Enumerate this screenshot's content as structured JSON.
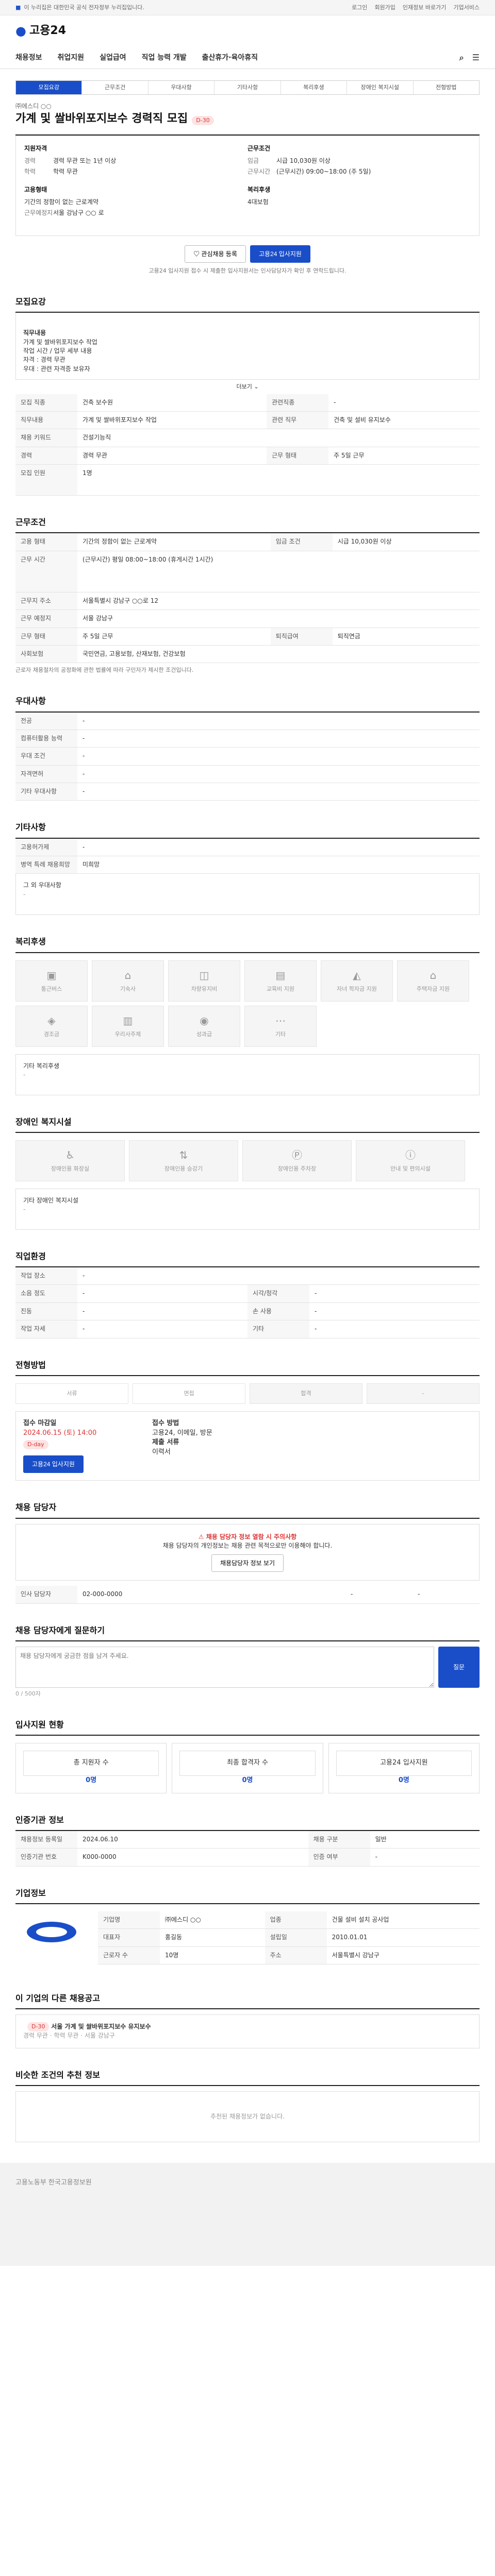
{
  "topbar": {
    "gov": "이 누리집은 대한민국 공식 전자정부 누리집입니다.",
    "links": [
      "로그인",
      "회원가입",
      "인재정보 바로가기",
      "기업서비스"
    ]
  },
  "logo": "고용24",
  "gnb": [
    "채용정보",
    "취업지원",
    "실업급여",
    "직업 능력 개발",
    "출산휴가·육아휴직"
  ],
  "tabs": [
    "모집요강",
    "근무조건",
    "우대사항",
    "기타사항",
    "복리후생",
    "장애인 복지시설",
    "전형방법"
  ],
  "title": {
    "company": "㈜에스디 ○○",
    "job": "가계 및 쌀바위포지보수 경력직 모집",
    "badge": "D-30"
  },
  "summary": {
    "h1": "지원자격",
    "k1": [
      "경력",
      "학력",
      "",
      "",
      "고용형태",
      "근무예정지"
    ],
    "v1": [
      "경력 무관 또는 1년 이상",
      "학력 무관",
      "",
      "",
      "기간의 정함이 없는 근로계약",
      "서울 강남구 ○○ 로"
    ],
    "h2": "근무조건",
    "k2": [
      "임금",
      "근무시간"
    ],
    "v2": [
      "시급 10,030원 이상",
      "(근무시간)  09:00~18:00 (주 5일)"
    ],
    "w": "복리후생",
    "wv": "4대보험"
  },
  "btns": {
    "fav": "관심채용 등록",
    "apply": "고용24 입사지원"
  },
  "note": "고용24 입사지원 접수 시 제출한 입사지원서는 인사담당자가 확인 후 연락드립니다.",
  "s1": {
    "title": "모집요강",
    "heading": "직무내용",
    "body": "가계 및 쌀바위포지보수 작업\n작업 시간 / 업무 세부 내용\n자격 : 경력 무관\n우대 : 관련 자격증 보유자",
    "more": "더보기"
  },
  "s1t": [
    [
      "모집 직종",
      "건축 보수원",
      "관련직종",
      "-"
    ],
    [
      "직무내용",
      "가계 및 쌀바위포지보수 작업",
      "관련 직무",
      "건축 및 설비 유지보수"
    ],
    [
      "채용 키워드",
      "건설기능직",
      "",
      ""
    ],
    [
      "경력",
      "경력 무관",
      "근무 형태",
      "주 5일 근무"
    ],
    [
      "모집 인원",
      "1명",
      "",
      ""
    ]
  ],
  "s2": {
    "title": "근무조건",
    "rows": [
      [
        "고용 형태",
        "기간의 정함이 없는 근로계약",
        "임금 조건",
        "시급 10,030원 이상"
      ],
      [
        "근무 시간",
        "(근무시간) 평일 08:00~18:00 (휴게시간 1시간)",
        "",
        ""
      ],
      [
        "근무지 주소",
        "서울특별시 강남구 ○○로 12",
        "",
        ""
      ],
      [
        "근무 예정지",
        "서울 강남구",
        "",
        ""
      ],
      [
        "근무 형태",
        "주 5일 근무",
        "퇴직급여",
        "퇴직연금"
      ],
      [
        "사회보험",
        "국민연금, 고용보험, 산재보험, 건강보험",
        "",
        ""
      ]
    ],
    "note": "근로자 채용절차의 공정화에 관한 법률에 따라 구인자가 제시한 조건입니다."
  },
  "s3": {
    "title": "우대사항",
    "rows": [
      [
        "전공",
        "-"
      ],
      [
        "컴퓨터활용 능력",
        "-"
      ],
      [
        "우대 조건",
        "-"
      ],
      [
        "자격면허",
        "-"
      ],
      [
        "기타 우대사항",
        "-"
      ]
    ]
  },
  "s4": {
    "title": "기타사항",
    "rows": [
      [
        "고용허가제",
        "-"
      ],
      [
        "병역 특례 채용희망",
        "미희망"
      ]
    ],
    "extra": "그 외 우대사항",
    "extraVal": "-"
  },
  "s5": {
    "title": "복리후생",
    "tiles": [
      "통근버스",
      "기숙사",
      "차량유지비",
      "교육비 지원",
      "자녀 학자금 지원",
      "주택자금 지원",
      "경조금",
      "우리사주제",
      "성과급",
      "기타"
    ],
    "otherLabel": "기타 복리후생",
    "otherVal": "-"
  },
  "s6": {
    "title": "장애인 복지시설",
    "tiles": [
      "장애인용 화장실",
      "장애인용 승강기",
      "장애인용 주차장",
      "안내 및 편의시설"
    ],
    "otherLabel": "기타 장애인 복지시설",
    "otherVal": "-"
  },
  "s7": {
    "title": "직업환경",
    "rows": [
      [
        "작업 장소",
        "-",
        "",
        ""
      ],
      [
        "소음 정도",
        "-",
        "시각/청각",
        "-"
      ],
      [
        "진동",
        "-",
        "손 사용",
        "-"
      ],
      [
        "작업 자세",
        "-",
        "기타",
        "-"
      ]
    ]
  },
  "s8": {
    "title": "전형방법",
    "steps": [
      "서류",
      "면접",
      "합격",
      "-"
    ],
    "deadLabel": "접수 마감일",
    "dead": "2024.06.15 (토) 14:00",
    "deadBadge": "D-day",
    "methodLabel": "접수 방법",
    "method": "고용24, 이메일, 방문",
    "docsLabel": "제출 서류",
    "docs": "이력서",
    "applyBtn": "고용24 입사지원"
  },
  "s9": {
    "title": "채용 담당자",
    "warn": "채용 담당자 정보 열람 시 주의사항",
    "warnBody": "채용 담당자의 개인정보는 채용 관련 목적으로만 이용해야 합니다.",
    "viewBtn": "채용담당자 정보 보기",
    "name": "인사 담당자",
    "phone": "02-000-0000",
    "fax": "-",
    "email": "-"
  },
  "s10": {
    "title": "채용 담당자에게 질문하기",
    "placeholder": "채용 담당자에게 궁금한 점을 남겨 주세요.",
    "btn": "질문",
    "count": "0 / 500자"
  },
  "s11": {
    "title": "입사지원 현황",
    "stats": [
      [
        "총 지원자 수",
        "0명"
      ],
      [
        "최종 합격자 수",
        "0명"
      ],
      [
        "고용24 입사지원",
        "0명"
      ]
    ]
  },
  "s12": {
    "title": "인증기관 정보",
    "rows": [
      [
        "채용정보 등록일",
        "2024.06.10",
        "채용 구분",
        "일반"
      ],
      [
        "인증기관 번호",
        "K000-0000",
        "인증 여부",
        "-"
      ]
    ]
  },
  "s13": {
    "title": "기업정보",
    "rows": [
      [
        "기업명",
        "㈜에스디 ○○",
        "업종",
        "건물 설비 설치 공사업"
      ],
      [
        "대표자",
        "홍길동",
        "설립일",
        "2010.01.01"
      ],
      [
        "근로자 수",
        "10명",
        "주소",
        "서울특별시 강남구"
      ]
    ]
  },
  "s14": {
    "title": "이 기업의 다른 채용공고",
    "job": "서울 가계 및 쌀바위포지보수 유지보수",
    "info": "경력 무관 · 학력 무관 · 서울 강남구",
    "dday": "D-30"
  },
  "s15": {
    "title": "비슷한 조건의 추천 정보",
    "empty": "추천된 채용정보가 없습니다."
  },
  "footer": "고용노동부 한국고용정보원"
}
